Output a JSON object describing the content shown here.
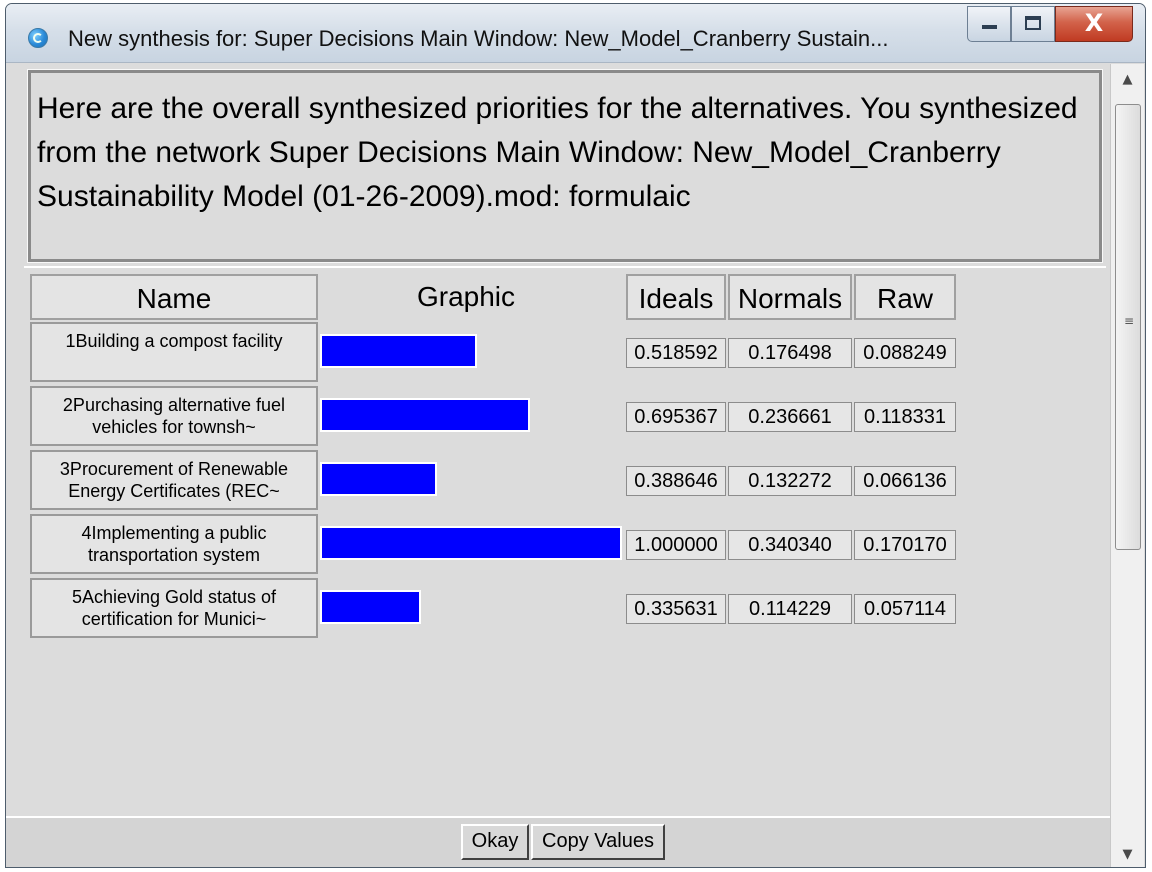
{
  "window": {
    "title": "New synthesis for: Super Decisions Main Window: New_Model_Cranberry Sustain...",
    "close_glyph": "X"
  },
  "header": {
    "message": "Here are the overall synthesized priorities for the alternatives.  You synthesized from the network Super Decisions Main Window: New_Model_Cranberry Sustainability Model (01-26-2009).mod: formulaic"
  },
  "columns": {
    "name": "Name",
    "graphic": "Graphic",
    "ideals": "Ideals",
    "normals": "Normals",
    "raw": "Raw"
  },
  "rows": [
    {
      "name": "1Building a compost facility",
      "ideal": 0.518592,
      "ideals_text": "0.518592",
      "normals_text": "0.176498",
      "raw_text": "0.088249"
    },
    {
      "name": "2Purchasing alternative fuel vehicles for townsh~",
      "ideal": 0.695367,
      "ideals_text": "0.695367",
      "normals_text": "0.236661",
      "raw_text": "0.118331"
    },
    {
      "name": "3Procurement of Renewable Energy Certificates (REC~",
      "ideal": 0.388646,
      "ideals_text": "0.388646",
      "normals_text": "0.132272",
      "raw_text": "0.066136"
    },
    {
      "name": "4Implementing a public transportation system",
      "ideal": 1.0,
      "ideals_text": "1.000000",
      "normals_text": "0.340340",
      "raw_text": "0.170170"
    },
    {
      "name": "5Achieving Gold status of certification for Munici~",
      "ideal": 0.335631,
      "ideals_text": "0.335631",
      "normals_text": "0.114229",
      "raw_text": "0.057114"
    }
  ],
  "buttons": {
    "okay": "Okay",
    "copy": "Copy Values"
  },
  "colors": {
    "bar": "#0000ff",
    "window_bg": "#dcdcdc"
  },
  "icons": {
    "app": "refresh-arrows-icon",
    "minimize": "minimize-icon",
    "maximize": "maximize-icon",
    "close": "close-icon",
    "scroll_up": "scroll-up-arrow-icon",
    "scroll_down": "scroll-down-arrow-icon"
  }
}
